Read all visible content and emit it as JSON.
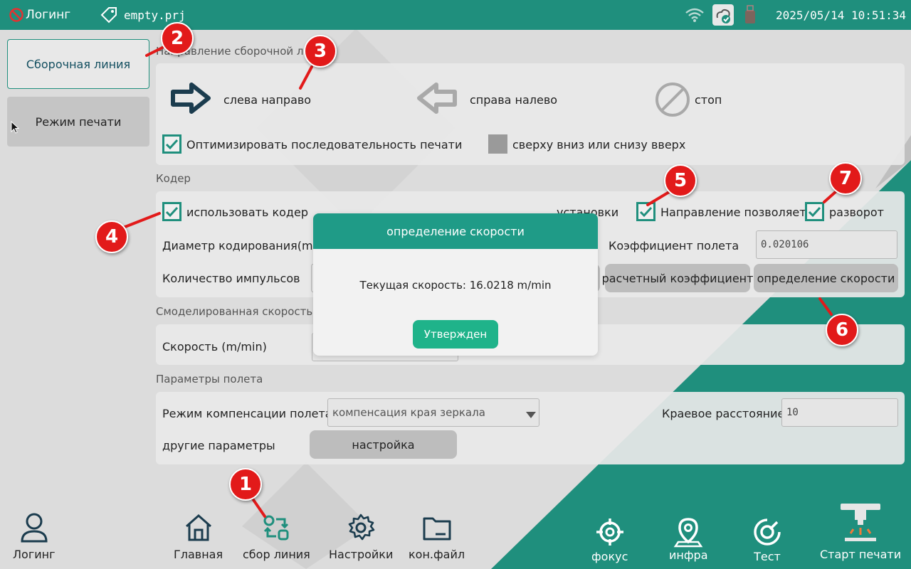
{
  "colors": {
    "teal": "#1f8f7d",
    "modal_header": "#1f9b87",
    "confirm_button": "#1fb38a",
    "callout": "#e21a1a"
  },
  "topbar": {
    "login": "Логинг",
    "project": "empty.prj",
    "datetime": "2025/05/14 10:51:34",
    "icons": [
      "no-entry-icon",
      "tag-icon",
      "wifi-icon",
      "cloud-check-icon",
      "usb-drive-icon"
    ]
  },
  "left_nav": {
    "assembly_line": "Сборочная линия",
    "print_mode": "Режим печати"
  },
  "direction": {
    "title": "Направление сборочной линии",
    "left_to_right": "слева направо",
    "right_to_left": "справа налево",
    "stop": "стоп",
    "optimize": "Оптимизировать последовательность печати",
    "optimize_checked": true,
    "top_bottom": "сверху вниз или снизу вверх",
    "top_bottom_checked": false
  },
  "encoder": {
    "title": "Кодер",
    "use_encoder": "использовать кодер",
    "use_encoder_checked": true,
    "install_label": "установки",
    "direction_allows": "Направление позволяет",
    "direction_allows_checked": true,
    "reverse": "разворот",
    "reverse_checked": true,
    "diameter_label": "Диаметр кодирования(mm)",
    "flight_coef_label": "Коэффициент полета",
    "flight_coef_value": "0.020106",
    "pulse_label": "Количество импульсов",
    "calc_coef_button": "расчетный коэффициент",
    "speed_detect_button": "определение скорости"
  },
  "simulated": {
    "title": "Смоделированная скорость",
    "speed_label": "Скорость (m/min)"
  },
  "flight": {
    "title": "Параметры полета",
    "comp_mode_label": "Режим компенсации полета",
    "comp_mode_value": "компенсация края зеркала",
    "edge_distance_label": "Краевое расстояние",
    "edge_distance_value": "10",
    "other_params_label": "другие параметры",
    "setup_button": "настройка"
  },
  "bottom_nav": {
    "login": "Логинг",
    "home": "Главная",
    "assembly": "сбор линия",
    "settings": "Настройки",
    "config_file": "кон.файл",
    "focus": "фокус",
    "infra": "инфра",
    "test": "Тест",
    "start_print": "Старт печати"
  },
  "modal": {
    "title": "определение скорости",
    "text": "Текущая скорость: 16.0218 m/min",
    "confirm": "Утвержден"
  },
  "callouts": {
    "c1": "1",
    "c2": "2",
    "c3": "3",
    "c4": "4",
    "c5": "5",
    "c6": "6",
    "c7": "7"
  }
}
